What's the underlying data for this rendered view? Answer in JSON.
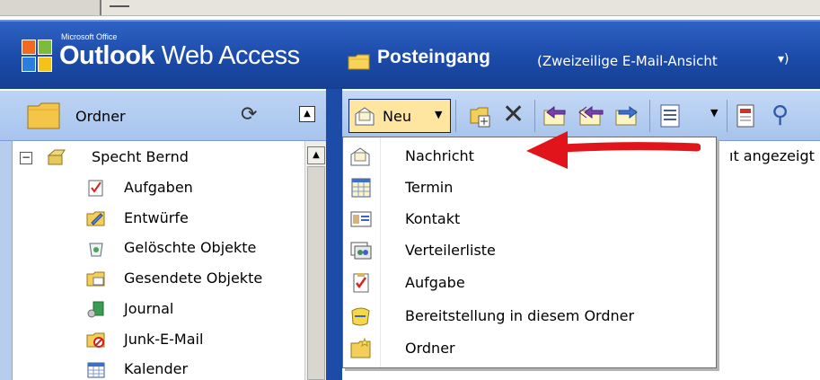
{
  "brand": {
    "small_text": "Microsoft Office",
    "name_bold": "Outlook",
    "name_regular": "Web Access"
  },
  "header": {
    "folder_title": "Posteingang",
    "view_label": "(Zweizeilige E-Mail-Ansicht",
    "view_chevron": "▾)"
  },
  "left_pane": {
    "title": "Ordner",
    "tree": [
      {
        "label": "Specht Bernd",
        "icon": "mailbox-icon"
      },
      {
        "label": "Aufgaben",
        "icon": "tasks-icon"
      },
      {
        "label": "Entwürfe",
        "icon": "drafts-icon"
      },
      {
        "label": "Gelöschte Objekte",
        "icon": "trash-icon"
      },
      {
        "label": "Gesendete Objekte",
        "icon": "sent-folder-icon"
      },
      {
        "label": "Journal",
        "icon": "journal-icon"
      },
      {
        "label": "Junk-E-Mail",
        "icon": "junk-icon"
      },
      {
        "label": "Kalender",
        "icon": "calendar-icon"
      }
    ]
  },
  "toolbar": {
    "new_label": "Neu"
  },
  "content": {
    "partial_note": "ıt angezeigt"
  },
  "new_menu": {
    "items": [
      {
        "label": "Nachricht",
        "icon": "message-icon"
      },
      {
        "label": "Termin",
        "icon": "appointment-icon"
      },
      {
        "label": "Kontakt",
        "icon": "contact-icon"
      },
      {
        "label": "Verteilerliste",
        "icon": "distribution-list-icon"
      },
      {
        "label": "Aufgabe",
        "icon": "task-icon"
      },
      {
        "label": "Bereitstellung in diesem Ordner",
        "icon": "post-icon"
      },
      {
        "label": "Ordner",
        "icon": "folder-icon"
      }
    ]
  },
  "colors": {
    "banner": "#1b4ba9",
    "toolbar": "#b4cdf1",
    "annotation_arrow": "#e0141a",
    "menu_highlight": "#ffe6a0"
  }
}
